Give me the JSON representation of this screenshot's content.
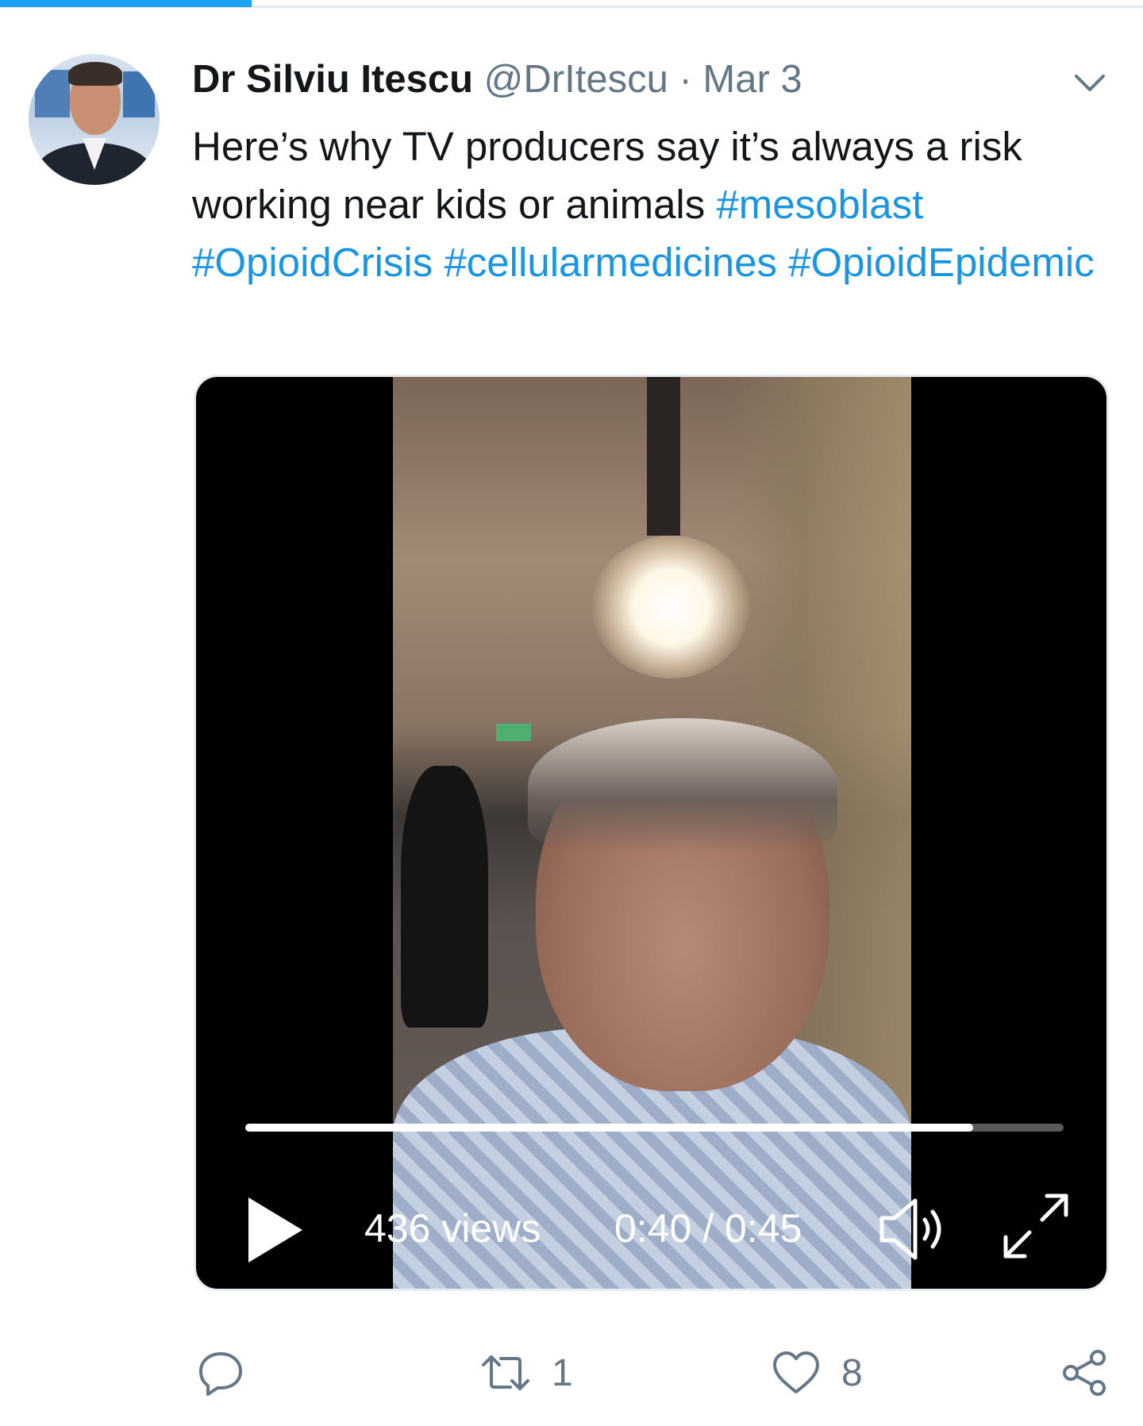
{
  "tweet": {
    "author_name": "Dr Silviu Itescu",
    "handle": "@DrItescu",
    "separator": "·",
    "date": "Mar 3",
    "text_plain": "Here’s why TV producers say it’s always a risk working near kids or animals",
    "hashtags": [
      "#mesoblast",
      "#OpioidCrisis",
      "#cellularmedicines",
      "#OpioidEpidemic"
    ]
  },
  "video": {
    "views": "436 views",
    "time": "0:40 / 0:45",
    "progress_fraction": 0.889
  },
  "actions": {
    "reply_count": "",
    "retweet_count": "1",
    "like_count": "8"
  },
  "icons": {
    "menu": "chevron-down-icon",
    "play": "play-icon",
    "volume": "volume-icon",
    "fullscreen": "fullscreen-icon",
    "reply": "reply-icon",
    "retweet": "retweet-icon",
    "like": "heart-icon",
    "share": "share-icon"
  },
  "colors": {
    "accent": "#1da1f2",
    "hashtag": "#1b95e0",
    "secondary_text": "#657786"
  }
}
